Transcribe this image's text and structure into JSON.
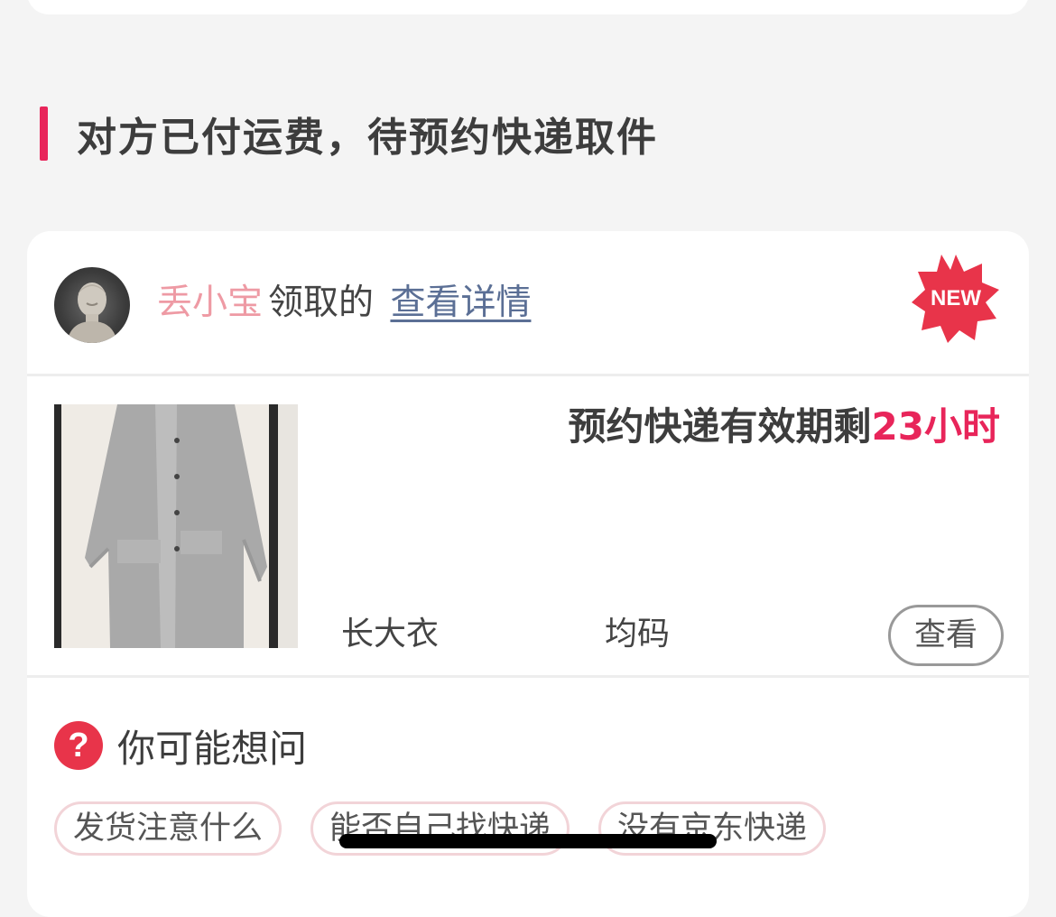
{
  "section": {
    "title": "对方已付运费，待预约快递取件"
  },
  "card": {
    "username": "丢小宝",
    "claim_text": "领取的",
    "detail_link": "查看详情",
    "new_badge": "NEW"
  },
  "product": {
    "expiry_prefix": "预约快递有效期剩",
    "expiry_hours": "23小时",
    "name": "长大衣",
    "size": "均码",
    "view_button": "查看"
  },
  "faq": {
    "icon": "?",
    "title": "你可能想问",
    "tags": [
      "发货注意什么",
      "能否自己找快递",
      "没有京东快递"
    ]
  },
  "colors": {
    "accent": "#e8255a",
    "username": "#ee9aa4",
    "link": "#5b6f95",
    "badge": "#e8344a"
  },
  "icons": [
    "avatar",
    "new-badge-icon",
    "question-icon"
  ]
}
